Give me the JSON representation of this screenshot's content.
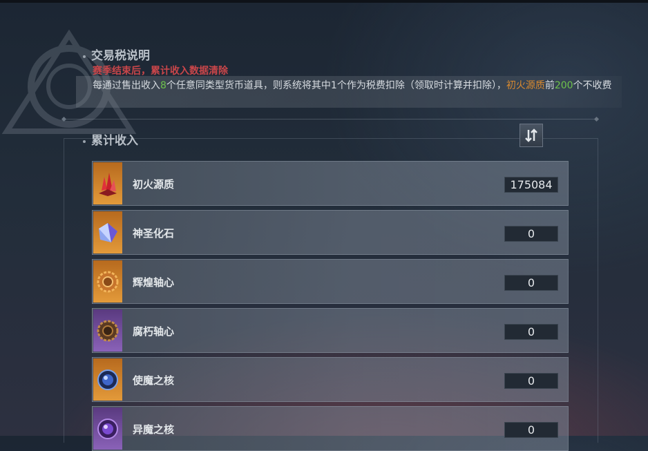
{
  "tax_section": {
    "title": "交易税说明",
    "warning": "赛季结束后，累计收入数据清除",
    "info_part1": "每通过售出收入",
    "info_num1": "8",
    "info_part2": "个任意同类型货币道具，则系统将其中1个作为税费扣除（领取时计算并扣除），",
    "info_item": "初火源质",
    "info_part3": "前",
    "info_num2": "200",
    "info_part4": "个不收费"
  },
  "income_section": {
    "title": "累计收入"
  },
  "items": [
    {
      "name": "初火源质",
      "value": "175084",
      "icon": "red-crystal-icon"
    },
    {
      "name": "神圣化石",
      "value": "0",
      "icon": "blue-gem-icon"
    },
    {
      "name": "辉煌轴心",
      "value": "0",
      "icon": "gold-gear-icon"
    },
    {
      "name": "腐朽轴心",
      "value": "0",
      "icon": "dark-gear-icon"
    },
    {
      "name": "使魔之核",
      "value": "0",
      "icon": "blue-core-icon"
    },
    {
      "name": "异魔之核",
      "value": "0",
      "icon": "purple-core-icon"
    }
  ]
}
